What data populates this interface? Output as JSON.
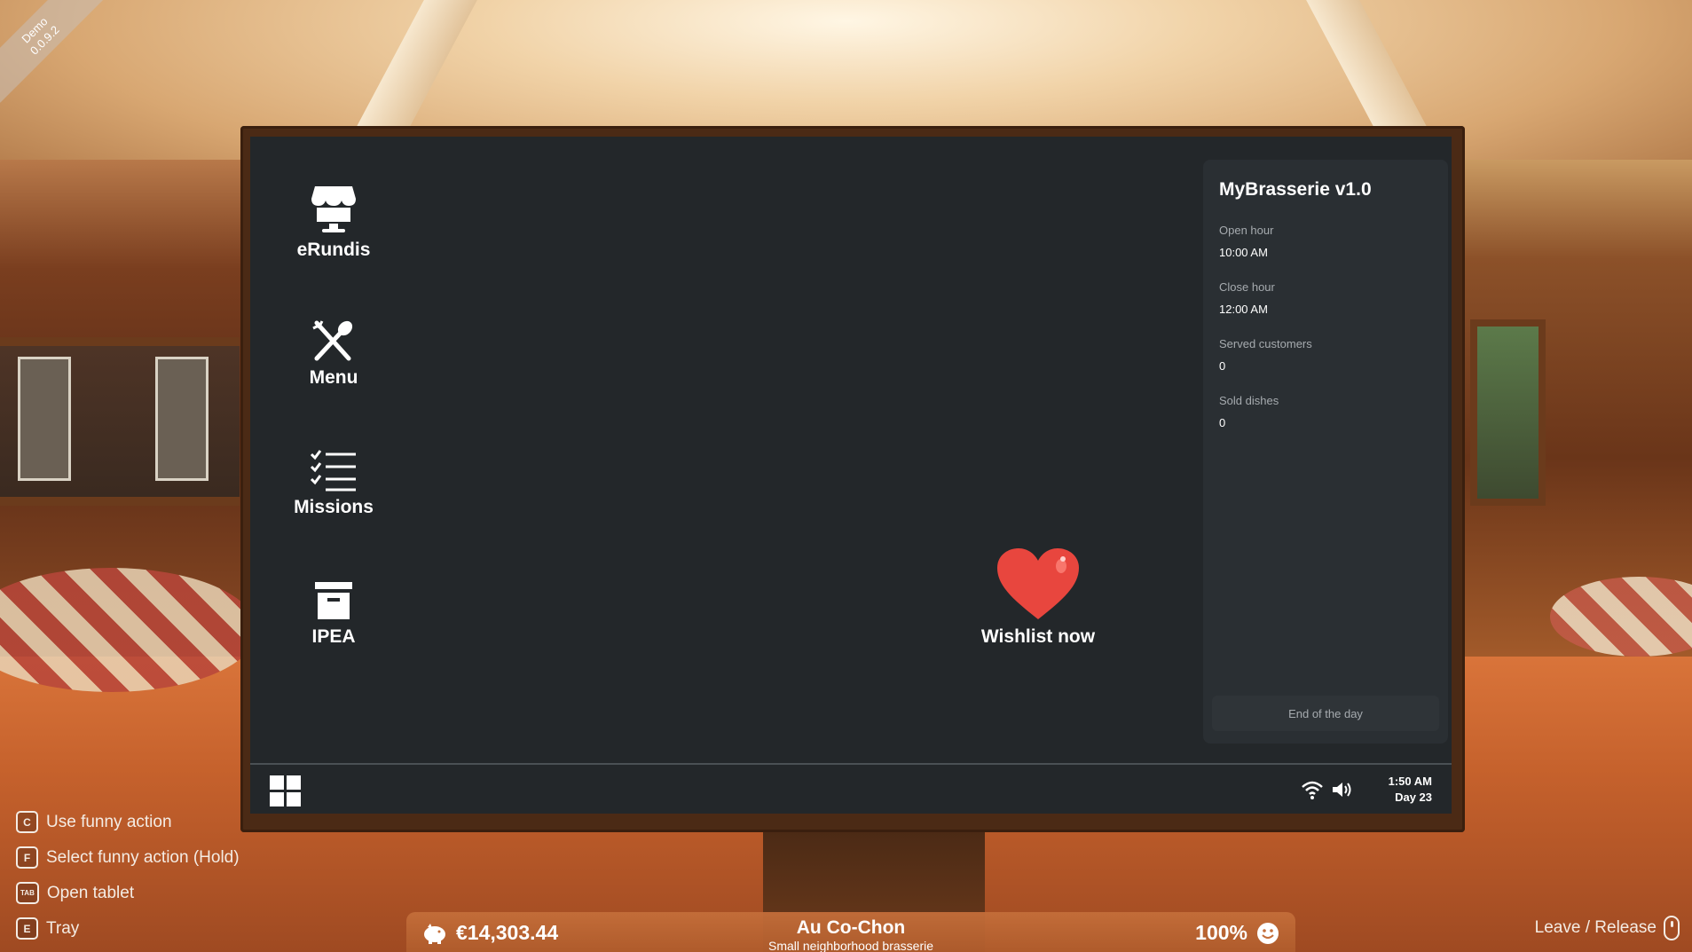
{
  "version_ribbon": {
    "line1": "Demo",
    "line2": "0.0.9.2"
  },
  "desktop": {
    "apps": [
      {
        "label": "eRundis",
        "icon": "shop-icon"
      },
      {
        "label": "Menu",
        "icon": "fork-spoon-icon"
      },
      {
        "label": "Missions",
        "icon": "checklist-icon"
      },
      {
        "label": "IPEA",
        "icon": "archive-box-icon"
      }
    ],
    "wishlist": {
      "label": "Wishlist now",
      "icon": "heart-icon",
      "color": "#e8463e"
    }
  },
  "info_panel": {
    "title": "MyBrasserie v1.0",
    "fields": [
      {
        "label": "Open hour",
        "value": "10:00 AM"
      },
      {
        "label": "Close hour",
        "value": "12:00 AM"
      },
      {
        "label": "Served customers",
        "value": "0"
      },
      {
        "label": "Sold dishes",
        "value": "0"
      }
    ],
    "end_day_button": "End of the day"
  },
  "taskbar": {
    "start_icon": "windows-grid-icon",
    "wifi_icon": "wifi-icon",
    "volume_icon": "speaker-icon",
    "time": "1:50 AM",
    "day": "Day 23"
  },
  "key_hints": [
    {
      "key": "C",
      "label": "Use funny action"
    },
    {
      "key": "F",
      "label": "Select funny action (Hold)"
    },
    {
      "key": "TAB",
      "label": "Open tablet"
    },
    {
      "key": "E",
      "label": "Tray"
    }
  ],
  "leave_hint": {
    "label": "Leave / Release",
    "icon": "mouse-icon"
  },
  "hud": {
    "money": "€14,303.44",
    "money_icon": "piggy-bank-icon",
    "restaurant_name": "Au Co-Chon",
    "restaurant_subtitle": "Small neighborhood brasserie",
    "satisfaction": "100%",
    "satisfaction_icon": "smiley-icon"
  },
  "colors": {
    "screen_bg": "#23272a",
    "panel_bg": "#2a2f33",
    "monitor_frame": "#4b2a15",
    "hud_bg": "#c46e3a"
  }
}
